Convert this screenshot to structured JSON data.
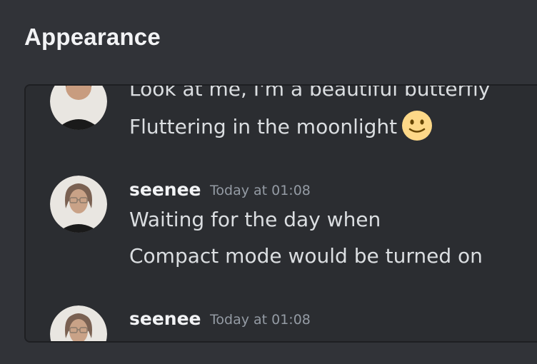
{
  "header": {
    "title": "Appearance"
  },
  "preview": {
    "messages": [
      {
        "lines": [
          "Look at me, I'm a beautiful butterfly",
          "Fluttering in the moonlight"
        ],
        "emoji": "slightly-smiling-face-emoji"
      },
      {
        "username": "seenee",
        "timestamp": "Today at 01:08",
        "lines": [
          "Waiting for the day when",
          "Compact mode would be turned on"
        ]
      },
      {
        "username": "seenee",
        "timestamp": "Today at 01:08"
      }
    ]
  },
  "colors": {
    "background": "#313338",
    "preview_background": "#2b2d31",
    "text": "#dbdee1",
    "timestamp": "#949ba4"
  }
}
